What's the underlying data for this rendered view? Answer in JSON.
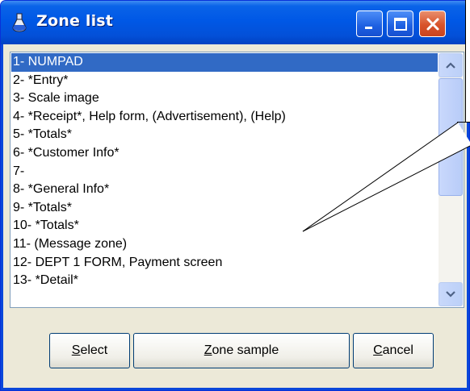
{
  "window": {
    "title": "Zone list"
  },
  "list": {
    "items": [
      {
        "label": "1- NUMPAD",
        "selected": true
      },
      {
        "label": "2- *Entry*"
      },
      {
        "label": "3- Scale image"
      },
      {
        "label": "4- *Receipt*, Help form, (Advertisement), (Help)"
      },
      {
        "label": "5- *Totals*"
      },
      {
        "label": "6- *Customer Info*"
      },
      {
        "label": "7-"
      },
      {
        "label": "8- *General Info*"
      },
      {
        "label": "9- *Totals*"
      },
      {
        "label": "10- *Totals*"
      },
      {
        "label": "11- (Message zone)"
      },
      {
        "label": "12- DEPT 1 FORM, Payment screen"
      },
      {
        "label": "13- *Detail*"
      }
    ]
  },
  "buttons": {
    "select": {
      "prefix": "",
      "mnemonic": "S",
      "rest": "elect"
    },
    "zone_sample": {
      "prefix": "",
      "mnemonic": "Z",
      "rest": "one sample"
    },
    "cancel": {
      "prefix": "",
      "mnemonic": "C",
      "rest": "ancel"
    }
  },
  "colors": {
    "titlebar": "#0058e6",
    "selection": "#316ac5",
    "client": "#ece9d8"
  }
}
